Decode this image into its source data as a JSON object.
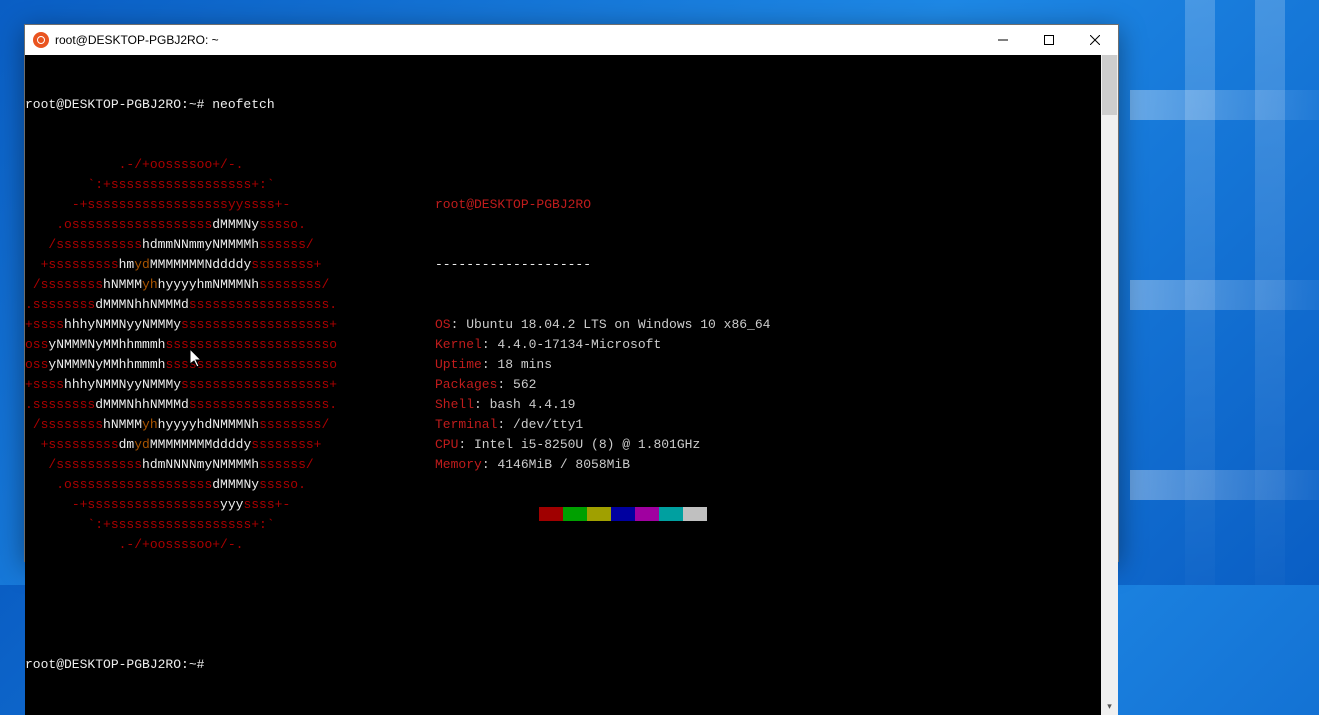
{
  "window": {
    "title": "root@DESKTOP-PGBJ2RO: ~"
  },
  "prompt": {
    "line1": "root@DESKTOP-PGBJ2RO:~# neofetch",
    "line2": "root@DESKTOP-PGBJ2RO:~# "
  },
  "logo": [
    {
      "pre": "            ",
      "r1": ".-/+oossssoo+/-."
    },
    {
      "pre": "        ",
      "r1": "`:+ssssssssssssssssss+:`"
    },
    {
      "pre": "      ",
      "r1": "-+ssssssssssssssssssyyssss+-"
    },
    {
      "pre": "    ",
      "r1": ".ossssssssssssssssss",
      "w1": "dMMMNy",
      "r2": "sssso."
    },
    {
      "pre": "   ",
      "r1": "/sssssssssss",
      "w1": "hdmmNNmmyNMMMMh",
      "r2": "ssssss/"
    },
    {
      "pre": "  ",
      "r1": "+sssssssss",
      "w1": "hm",
      "y1": "yd",
      "w2": "MMMMMMMNddddy",
      "r2": "ssssssss+"
    },
    {
      "pre": " ",
      "r1": "/ssssssss",
      "w1": "hNMMM",
      "y1": "yh",
      "w2": "hyyyyhmNMMMNh",
      "r2": "ssssssss/"
    },
    {
      "pre": "",
      "r1": ".ssssssss",
      "w1": "dMMMNh",
      "r2": "ssssssssss",
      "w2": "hNMMMd",
      "r3": "ssssssss."
    },
    {
      "pre": "",
      "r1": "+ssss",
      "w1": "hhhyNMMNy",
      "r2": "ssssssssssss",
      "w2": "yNMMMy",
      "r3": "sssssss+"
    },
    {
      "pre": "",
      "r1": "oss",
      "w1": "yNMMMNyMMh",
      "r2": "ssssssssssssss",
      "w2": "hmmmh",
      "r3": "ssssssso"
    },
    {
      "pre": "",
      "r1": "oss",
      "w1": "yNMMMNyMMh",
      "r2": "sssssssssssssss",
      "w2": "hmmmh",
      "r3": "sssssso"
    },
    {
      "pre": "",
      "r1": "+ssss",
      "w1": "hhhyNMMNy",
      "r2": "ssssssssssss",
      "w2": "yNMMMy",
      "r3": "sssssss+"
    },
    {
      "pre": "",
      "r1": ".ssssssss",
      "w1": "dMMMNh",
      "r2": "ssssssssss",
      "w2": "hNMMMd",
      "r3": "ssssssss."
    },
    {
      "pre": " ",
      "r1": "/ssssssss",
      "w1": "hNMMM",
      "y1": "yh",
      "w2": "hyyyyhdNMMMNh",
      "r2": "ssssssss/"
    },
    {
      "pre": "  ",
      "r1": "+sssssssss",
      "w1": "dm",
      "y1": "yd",
      "w2": "MMMMMMMMddddy",
      "r2": "ssssssss+"
    },
    {
      "pre": "   ",
      "r1": "/sssssssssss",
      "w1": "hdmNNNNmyNMMMMh",
      "r2": "ssssss/"
    },
    {
      "pre": "    ",
      "r1": ".ossssssssssssssssss",
      "w1": "dMMMNy",
      "r2": "sssso."
    },
    {
      "pre": "      ",
      "r1": "-+sssssssssssssssss",
      "w1": "yyy",
      "r2": "ssss+-"
    },
    {
      "pre": "        ",
      "r1": "`:+ssssssssssssssssss+:`"
    },
    {
      "pre": "            ",
      "r1": ".-/+oossssoo+/-."
    }
  ],
  "info": {
    "header": "root@DESKTOP-PGBJ2RO",
    "divider": "--------------------",
    "rows": [
      {
        "label": "OS",
        "value": ": Ubuntu 18.04.2 LTS on Windows 10 x86_64"
      },
      {
        "label": "Kernel",
        "value": ": 4.4.0-17134-Microsoft"
      },
      {
        "label": "Uptime",
        "value": ": 18 mins"
      },
      {
        "label": "Packages",
        "value": ": 562"
      },
      {
        "label": "Shell",
        "value": ": bash 4.4.19"
      },
      {
        "label": "Terminal",
        "value": ": /dev/tty1"
      },
      {
        "label": "CPU",
        "value": ": Intel i5-8250U (8) @ 1.801GHz"
      },
      {
        "label": "Memory",
        "value": ": 4146MiB / 8058MiB"
      }
    ],
    "swatches": [
      "#a00000",
      "#00a000",
      "#a0a000",
      "#0000a0",
      "#a000a0",
      "#00a0a0",
      "#c0c0c0"
    ]
  }
}
